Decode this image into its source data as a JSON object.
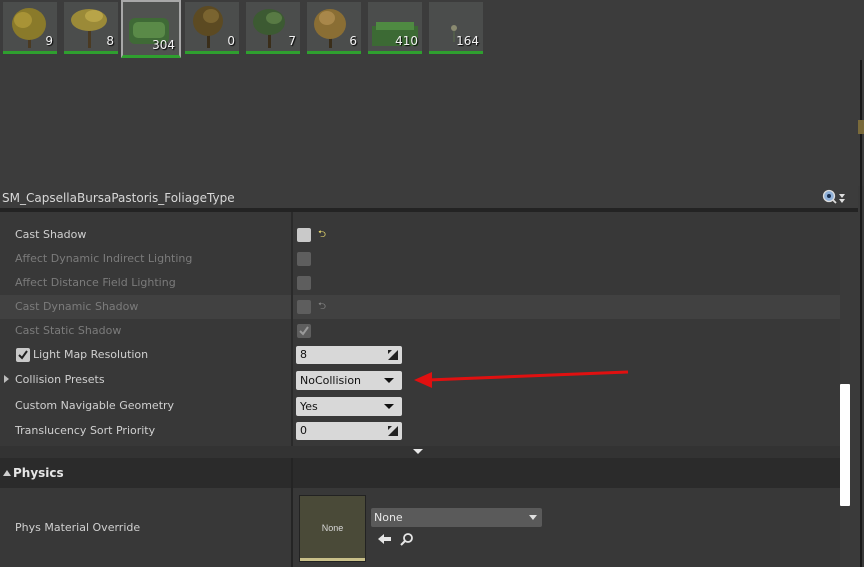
{
  "palette": {
    "items": [
      {
        "count": "9"
      },
      {
        "count": "8"
      },
      {
        "count": "304"
      },
      {
        "count": "0"
      },
      {
        "count": "7"
      },
      {
        "count": "6"
      },
      {
        "count": "410"
      },
      {
        "count": "164"
      }
    ]
  },
  "details": {
    "title": "SM_CapsellaBursaPastoris_FoliageType",
    "options_icon": "eye-search-icon"
  },
  "properties": {
    "cast_shadow": "Cast Shadow",
    "affect_indirect": "Affect Dynamic Indirect Lighting",
    "affect_distance": "Affect Distance Field Lighting",
    "cast_dynamic": "Cast Dynamic Shadow",
    "cast_static": "Cast Static Shadow",
    "lightmap_res": "Light Map Resolution",
    "lightmap_value": "8",
    "collision_presets": "Collision Presets",
    "collision_value": "NoCollision",
    "nav_geometry": "Custom Navigable Geometry",
    "nav_value": "Yes",
    "sort_priority": "Translucency Sort Priority",
    "sort_value": "0"
  },
  "physics": {
    "category": "Physics",
    "phys_material": "Phys Material Override",
    "thumb_text": "None",
    "combo_value": "None"
  },
  "colors": {
    "accent_green": "#2f9f2f",
    "annotation_red": "#e01010"
  }
}
